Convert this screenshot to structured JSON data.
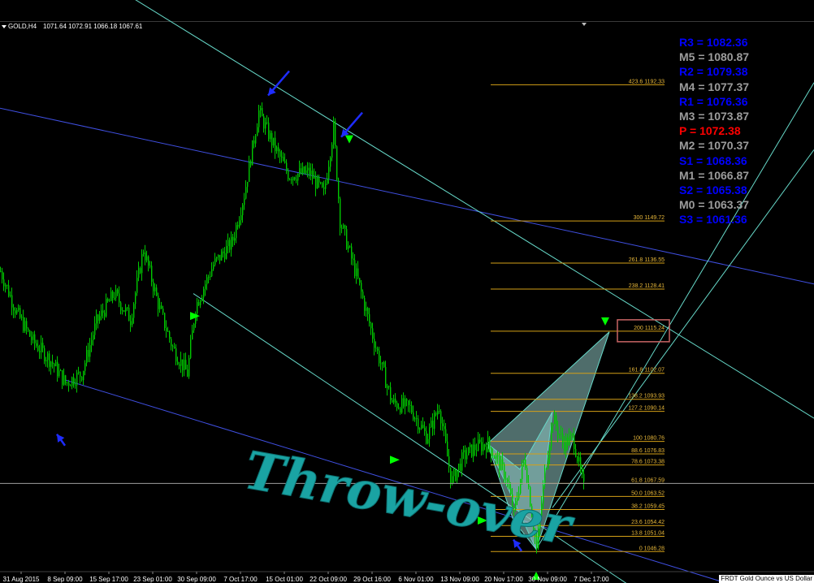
{
  "header": {
    "symbol": "GOLD,H4",
    "ohlc": "1071.64 1072.91 1066.18 1067.61"
  },
  "pivots": [
    {
      "label": "R3",
      "value": "1082.36",
      "color": "#0000ff"
    },
    {
      "label": "M5",
      "value": "1080.87",
      "color": "#9c9c9c"
    },
    {
      "label": "R2",
      "value": "1079.38",
      "color": "#0000ff"
    },
    {
      "label": "M4",
      "value": "1077.37",
      "color": "#9c9c9c"
    },
    {
      "label": "R1",
      "value": "1076.36",
      "color": "#0000ff"
    },
    {
      "label": "M3",
      "value": "1073.87",
      "color": "#9c9c9c"
    },
    {
      "label": "P ",
      "value": "1072.38",
      "color": "#ff0000"
    },
    {
      "label": "M2",
      "value": "1070.37",
      "color": "#9c9c9c"
    },
    {
      "label": "S1",
      "value": "1068.36",
      "color": "#0000ff"
    },
    {
      "label": "M1",
      "value": "1066.87",
      "color": "#9c9c9c"
    },
    {
      "label": "S2",
      "value": "1065.38",
      "color": "#0000ff"
    },
    {
      "label": "M0",
      "value": "1063.37",
      "color": "#9c9c9c"
    },
    {
      "label": "S3",
      "value": "1061.36",
      "color": "#0000ff"
    }
  ],
  "annotation_text": "Throw-over",
  "bottom_label": "FRDT Gold Ounce vs US Dollar",
  "colors": {
    "background": "#000000",
    "candles": "#00c800",
    "fib": "#d4a017",
    "fib_text": "#e8b83a",
    "channel": "#3f4fe0",
    "cyan": "#66d8c8",
    "arrow_blue": "#1e2cff",
    "arrow_green": "#00ff00",
    "annotation": "#1aa3a3"
  },
  "chart_data": {
    "type": "candlestick",
    "title": "GOLD,H4",
    "x_ticks": [
      "31 Aug 2015",
      "8 Sep 09:00",
      "15 Sep 17:00",
      "23 Sep 01:00",
      "30 Sep 09:00",
      "7 Oct 17:00",
      "15 Oct 01:00",
      "22 Oct 09:00",
      "29 Oct 16:00",
      "6 Nov 01:00",
      "13 Nov 09:00",
      "20 Nov 17:00",
      "30 Nov 09:00",
      "7 Dec 17:00"
    ],
    "ylim": [
      1040,
      1212
    ],
    "price_path": [
      [
        0,
        1134
      ],
      [
        20,
        1121
      ],
      [
        40,
        1112
      ],
      [
        62,
        1106
      ],
      [
        80,
        1099
      ],
      [
        100,
        1102
      ],
      [
        118,
        1118
      ],
      [
        140,
        1127
      ],
      [
        160,
        1119
      ],
      [
        176,
        1141
      ],
      [
        196,
        1122
      ],
      [
        212,
        1110
      ],
      [
        230,
        1102
      ],
      [
        240,
        1123
      ],
      [
        262,
        1136
      ],
      [
        285,
        1143
      ],
      [
        300,
        1158
      ],
      [
        318,
        1184
      ],
      [
        335,
        1174
      ],
      [
        355,
        1164
      ],
      [
        380,
        1165
      ],
      [
        398,
        1158
      ],
      [
        410,
        1179
      ],
      [
        418,
        1150
      ],
      [
        440,
        1131
      ],
      [
        460,
        1112
      ],
      [
        482,
        1093
      ],
      [
        505,
        1091
      ],
      [
        525,
        1082
      ],
      [
        540,
        1092
      ],
      [
        555,
        1068
      ],
      [
        570,
        1076
      ],
      [
        585,
        1079
      ],
      [
        600,
        1080
      ],
      [
        622,
        1070
      ],
      [
        632,
        1058
      ],
      [
        645,
        1076
      ],
      [
        660,
        1047
      ],
      [
        670,
        1071
      ],
      [
        680,
        1088
      ],
      [
        693,
        1080
      ],
      [
        705,
        1082
      ],
      [
        718,
        1066
      ]
    ],
    "fib_levels": [
      {
        "label": "423.6 1192.33",
        "value": 1192.33
      },
      {
        "label": "300 1149.72",
        "value": 1149.72
      },
      {
        "label": "261.8 1136.55",
        "value": 1136.55
      },
      {
        "label": "238.2 1128.41",
        "value": 1128.41
      },
      {
        "label": "200 1115.24",
        "value": 1115.24
      },
      {
        "label": "161.8 1102.07",
        "value": 1102.07
      },
      {
        "label": "138.2 1093.93",
        "value": 1093.93
      },
      {
        "label": "127.2 1090.14",
        "value": 1090.14
      },
      {
        "label": "100 1080.76",
        "value": 1080.76
      },
      {
        "label": "88.6 1076.83",
        "value": 1076.83
      },
      {
        "label": "78.6 1073.38",
        "value": 1073.38
      },
      {
        "label": "61.8 1067.59",
        "value": 1067.59
      },
      {
        "label": "50.0 1063.52",
        "value": 1063.52
      },
      {
        "label": "38.2 1059.45",
        "value": 1059.45
      },
      {
        "label": "23.6 1054.42",
        "value": 1054.42
      },
      {
        "label": "13.8 1051.04",
        "value": 1051.04
      },
      {
        "label": "0 1046.28",
        "value": 1046.28
      }
    ],
    "current_price": 1067.61,
    "channel_lines": [
      {
        "color": "channel",
        "from": [
          0,
          1185
        ],
        "to": [
          1002,
          1130
        ]
      },
      {
        "color": "channel",
        "from": [
          80,
          1100
        ],
        "to": [
          1002,
          1028
        ]
      },
      {
        "color": "cyan",
        "from": [
          160,
          1220
        ],
        "to": [
          1002,
          1088
        ]
      },
      {
        "color": "cyan",
        "from": [
          238,
          1127
        ],
        "to": [
          820,
          1028
        ]
      },
      {
        "color": "cyan",
        "from": [
          660,
          1047
        ],
        "to": [
          1002,
          1193
        ]
      },
      {
        "color": "cyan",
        "from": [
          680,
          1060
        ],
        "to": [
          1002,
          1172
        ]
      }
    ],
    "pattern_polygons": [
      [
        [
          600,
          1080
        ],
        [
          632,
          1056
        ],
        [
          660,
          1047
        ],
        [
          750,
          1115
        ]
      ],
      [
        [
          600,
          1080
        ],
        [
          640,
          1072
        ],
        [
          680,
          1090
        ],
        [
          660,
          1047
        ]
      ]
    ],
    "arrows": [
      {
        "color": "arrow_blue",
        "tip": [
          70,
          1083
        ],
        "dir": "up"
      },
      {
        "color": "arrow_blue",
        "tip": [
          330,
          1189
        ],
        "dir": "down"
      },
      {
        "color": "arrow_blue",
        "tip": [
          420,
          1176
        ],
        "dir": "down"
      },
      {
        "color": "arrow_blue",
        "tip": [
          632,
          1050
        ],
        "dir": "up"
      },
      {
        "color": "arrow_green",
        "tip": [
          430,
          1174
        ],
        "dir": "down"
      },
      {
        "color": "arrow_green",
        "tip": [
          246,
          1120
        ],
        "dir": "right"
      },
      {
        "color": "arrow_green",
        "tip": [
          492,
          1075
        ],
        "dir": "right"
      },
      {
        "color": "arrow_green",
        "tip": [
          600,
          1056
        ],
        "dir": "right"
      },
      {
        "color": "arrow_green",
        "tip": [
          660,
          1040
        ],
        "dir": "up"
      },
      {
        "color": "arrow_green",
        "tip": [
          745,
          1117
        ],
        "dir": "down"
      }
    ],
    "highlight_box": {
      "value": 1115.24,
      "x_from": 760,
      "x_to": 824
    }
  }
}
